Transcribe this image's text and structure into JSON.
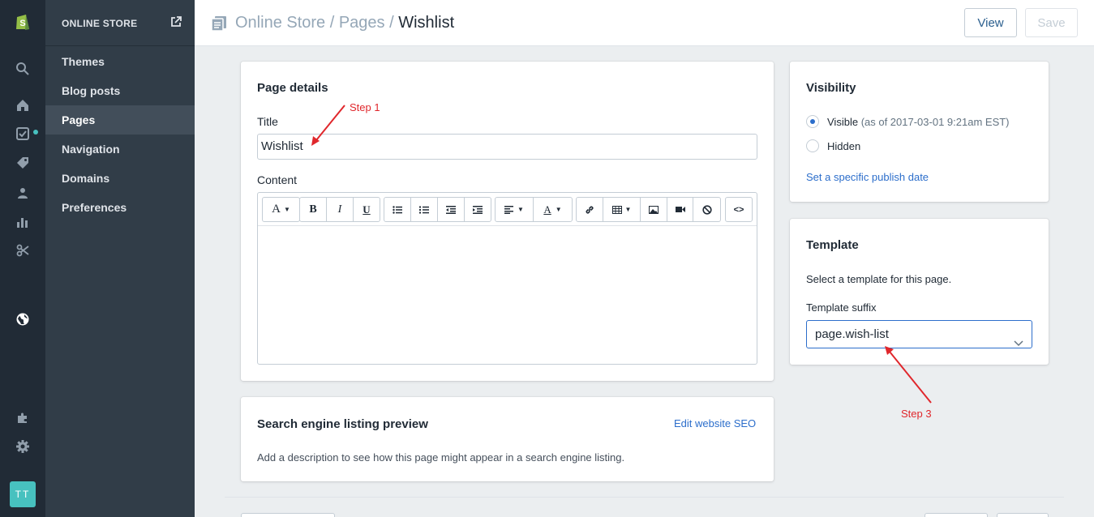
{
  "sidebar": {
    "title": "ONLINE STORE",
    "items": [
      {
        "label": "Themes",
        "active": false
      },
      {
        "label": "Blog posts",
        "active": false
      },
      {
        "label": "Pages",
        "active": true
      },
      {
        "label": "Navigation",
        "active": false
      },
      {
        "label": "Domains",
        "active": false
      },
      {
        "label": "Preferences",
        "active": false
      }
    ]
  },
  "rail": {
    "icons": [
      "shopify-logo-icon",
      "search-icon",
      "home-icon",
      "orders-icon",
      "tag-icon",
      "customers-icon",
      "analytics-icon",
      "discounts-icon",
      "globe-icon",
      "apps-icon",
      "settings-icon"
    ],
    "avatar_initials": "TT"
  },
  "header": {
    "breadcrumb_1": "Online Store",
    "sep_1": " / ",
    "breadcrumb_2": "Pages",
    "sep_2": " / ",
    "current": "Wishlist",
    "view_label": "View",
    "save_label": "Save"
  },
  "page_details": {
    "heading": "Page details",
    "title_label": "Title",
    "title_value": "Wishlist",
    "content_label": "Content",
    "toolbar_icons": [
      "font-icon",
      "bold-icon",
      "italic-icon",
      "underline-icon",
      "bullet-list-icon",
      "numbered-list-icon",
      "outdent-icon",
      "indent-icon",
      "align-icon",
      "text-color-icon",
      "link-icon",
      "table-icon",
      "image-icon",
      "video-icon",
      "clear-format-icon",
      "code-icon"
    ]
  },
  "seo": {
    "heading": "Search engine listing preview",
    "edit_link": "Edit website SEO",
    "description": "Add a description to see how this page might appear in a search engine listing."
  },
  "visibility": {
    "heading": "Visibility",
    "visible_label": "Visible",
    "visible_note": "(as of 2017-03-01 9:21am EST)",
    "hidden_label": "Hidden",
    "selected": "Visible",
    "publish_link": "Set a specific publish date"
  },
  "template": {
    "heading": "Template",
    "description": "Select a template for this page.",
    "suffix_label": "Template suffix",
    "suffix_value": "page.wish-list"
  },
  "annotations": {
    "step1": "Step 1",
    "step3": "Step 3"
  },
  "colors": {
    "rail_bg": "#212b36",
    "sidebar_bg": "#313d48",
    "link": "#2c6ecb",
    "annotation": "#e0272c",
    "avatar": "#47c1bf"
  }
}
